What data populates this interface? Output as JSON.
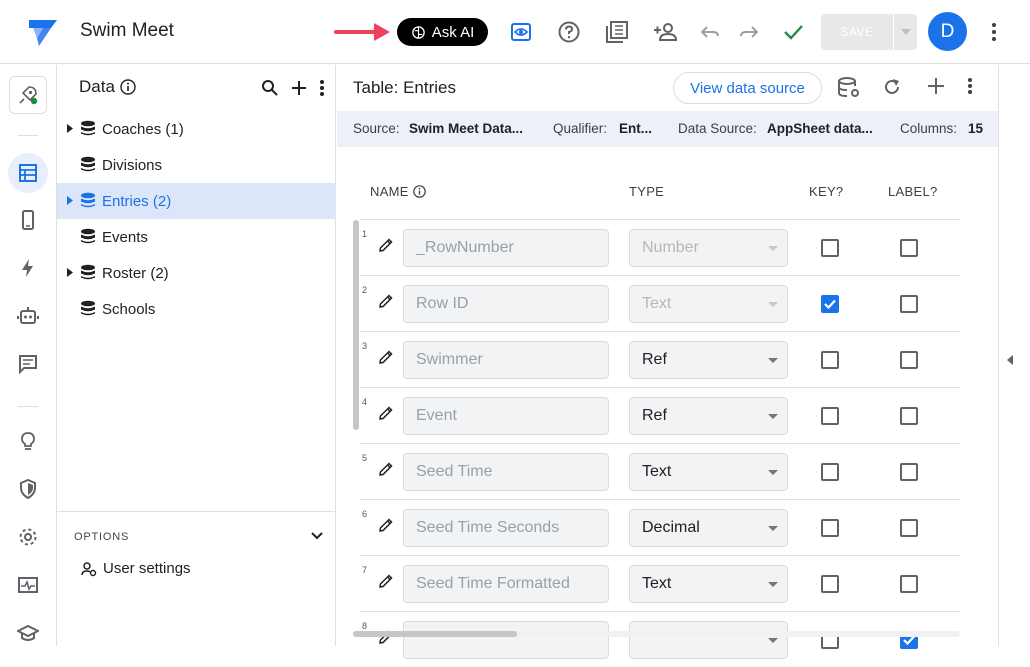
{
  "app": {
    "title": "Swim Meet",
    "ask_ai_label": "Ask AI",
    "save_label": "SAVE",
    "avatar_initial": "D",
    "colors": {
      "accent": "#1a73e8",
      "arrow": "#ef3f63",
      "confirm": "#1e8e3e"
    }
  },
  "toolbar_icons": [
    "preview-icon",
    "help-icon",
    "gallery-icon",
    "share-user-icon",
    "undo-icon",
    "redo-icon",
    "check-icon",
    "more-icon"
  ],
  "rail": {
    "items": [
      "launch-icon",
      "data-icon",
      "views-icon",
      "actions-icon",
      "automation-icon",
      "chat-icon",
      "intelligence-icon",
      "security-icon",
      "settings-icon",
      "monitor-icon",
      "learn-icon"
    ]
  },
  "data_panel": {
    "header": "Data",
    "tables": [
      {
        "label": "Coaches (1)",
        "expandable": true
      },
      {
        "label": "Divisions",
        "expandable": false
      },
      {
        "label": "Entries (2)",
        "expandable": true,
        "selected": true
      },
      {
        "label": "Events",
        "expandable": false
      },
      {
        "label": "Roster (2)",
        "expandable": true
      },
      {
        "label": "Schools",
        "expandable": false
      }
    ],
    "options_header": "OPTIONS",
    "user_settings_label": "User settings"
  },
  "main": {
    "title": "Table: Entries",
    "view_source_label": "View data source",
    "info": {
      "source_label": "Source:",
      "source_value": "Swim Meet Data...",
      "qualifier_label": "Qualifier:",
      "qualifier_value": "Ent...",
      "datasource_label": "Data Source:",
      "datasource_value": "AppSheet data...",
      "columns_label": "Columns:",
      "columns_value": "15"
    },
    "headers": {
      "name": "NAME",
      "type": "TYPE",
      "key": "KEY?",
      "label": "LABEL?"
    },
    "rows": [
      {
        "num": "1",
        "name": "_RowNumber",
        "type": "Number",
        "type_disabled": true,
        "key": false,
        "label": false
      },
      {
        "num": "2",
        "name": "Row ID",
        "type": "Text",
        "type_disabled": true,
        "key": true,
        "label": false
      },
      {
        "num": "3",
        "name": "Swimmer",
        "type": "Ref",
        "type_disabled": false,
        "key": false,
        "label": false
      },
      {
        "num": "4",
        "name": "Event",
        "type": "Ref",
        "type_disabled": false,
        "key": false,
        "label": false
      },
      {
        "num": "5",
        "name": "Seed Time",
        "type": "Text",
        "type_disabled": false,
        "key": false,
        "label": false
      },
      {
        "num": "6",
        "name": "Seed Time Seconds",
        "type": "Decimal",
        "type_disabled": false,
        "key": false,
        "label": false
      },
      {
        "num": "7",
        "name": "Seed Time Formatted",
        "type": "Text",
        "type_disabled": false,
        "key": false,
        "label": false
      },
      {
        "num": "8",
        "name": "",
        "type": "",
        "type_disabled": false,
        "key": false,
        "label": true
      }
    ]
  }
}
